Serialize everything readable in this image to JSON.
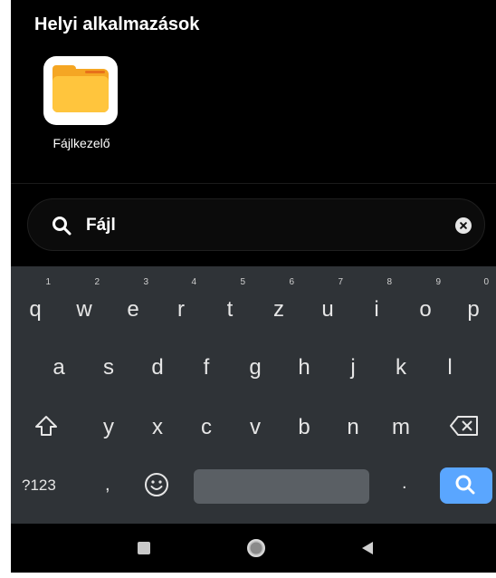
{
  "section_title": "Helyi alkalmazások",
  "app": {
    "label": "Fájlkezelő",
    "icon": "folder-icon"
  },
  "search": {
    "query": "Fájl",
    "icon": "search-icon",
    "clear_icon": "clear-icon"
  },
  "keyboard": {
    "row1": [
      {
        "key": "q",
        "hint": "1"
      },
      {
        "key": "w",
        "hint": "2"
      },
      {
        "key": "e",
        "hint": "3"
      },
      {
        "key": "r",
        "hint": "4"
      },
      {
        "key": "t",
        "hint": "5"
      },
      {
        "key": "z",
        "hint": "6"
      },
      {
        "key": "u",
        "hint": "7"
      },
      {
        "key": "i",
        "hint": "8"
      },
      {
        "key": "o",
        "hint": "9"
      },
      {
        "key": "p",
        "hint": "0"
      }
    ],
    "row2": [
      "a",
      "s",
      "d",
      "f",
      "g",
      "h",
      "j",
      "k",
      "l"
    ],
    "row3": [
      "y",
      "x",
      "c",
      "v",
      "b",
      "n",
      "m"
    ],
    "symbols_label": "?123",
    "comma": ",",
    "period": ".",
    "shift_icon": "shift-icon",
    "backspace_icon": "backspace-icon",
    "emoji_icon": "emoji-icon",
    "action_icon": "search-icon"
  },
  "navbar": {
    "recents_icon": "square-icon",
    "home_icon": "circle-icon",
    "back_icon": "triangle-back-icon"
  },
  "colors": {
    "background": "#000000",
    "keyboard_bg": "#2f3337",
    "accent": "#5aa6ff",
    "folder": "#ffc53d"
  }
}
